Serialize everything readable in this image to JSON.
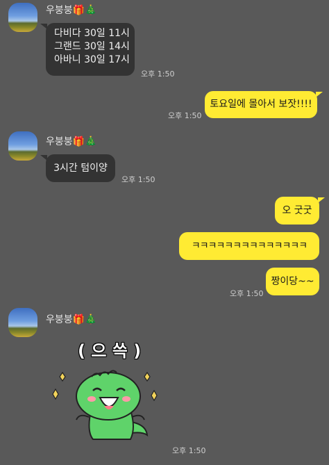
{
  "chat": {
    "sender_name": "우붕붕",
    "sender_emoji": "🎁🎄",
    "groups": [
      {
        "messages": [
          "다비다 30일 11시\n그랜드 30일 14시\n아바니 30일 17시"
        ],
        "time": "오후 1:50"
      },
      {
        "messages": [
          "3시간 텀이양"
        ],
        "time": "오후 1:50"
      },
      {
        "sticker_label": "( 으 쓱 )",
        "sticker_icon": "dinosaur-sticker",
        "time": "오후 1:50"
      }
    ],
    "outgoing": [
      {
        "messages": [
          "토요일에 몰아서 보잣!!!!"
        ],
        "time": "오후 1:50"
      },
      {
        "messages": [
          "오 굿굿",
          "ㅋㅋㅋㅋㅋㅋㅋㅋㅋㅋㅋㅋㅋㅋ",
          "짱이당~~"
        ],
        "time": "오후 1:50"
      }
    ]
  },
  "colors": {
    "background": "#595959",
    "incoming_bubble": "#333333",
    "outgoing_bubble": "#ffeb33",
    "sticker_green": "#5fd36a"
  }
}
